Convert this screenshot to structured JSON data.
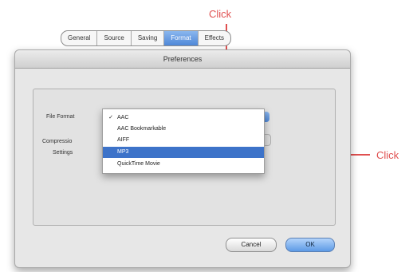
{
  "annotations": {
    "top": "Click",
    "right": "Click",
    "color": "#e05050"
  },
  "window": {
    "title": "Preferences"
  },
  "tabs": [
    {
      "label": "General",
      "selected": false
    },
    {
      "label": "Source",
      "selected": false
    },
    {
      "label": "Saving",
      "selected": false
    },
    {
      "label": "Format",
      "selected": true
    },
    {
      "label": "Effects",
      "selected": false
    }
  ],
  "form": {
    "file_format_label": "File Format",
    "compression_label": "Compressio",
    "settings_label": "Settings"
  },
  "file_format_menu": {
    "items": [
      {
        "label": "AAC",
        "checked": true,
        "highlighted": false
      },
      {
        "label": "AAC Bookmarkable",
        "checked": false,
        "highlighted": false
      },
      {
        "label": "AIFF",
        "checked": false,
        "highlighted": false
      },
      {
        "label": "MP3",
        "checked": false,
        "highlighted": true
      },
      {
        "label": "QuickTime Movie",
        "checked": false,
        "highlighted": false
      }
    ],
    "checkmark": "✓"
  },
  "buttons": {
    "cancel": "Cancel",
    "ok": "OK"
  },
  "colors": {
    "highlight": "#3d73c9",
    "accent_blue": "#5d9ae6"
  }
}
